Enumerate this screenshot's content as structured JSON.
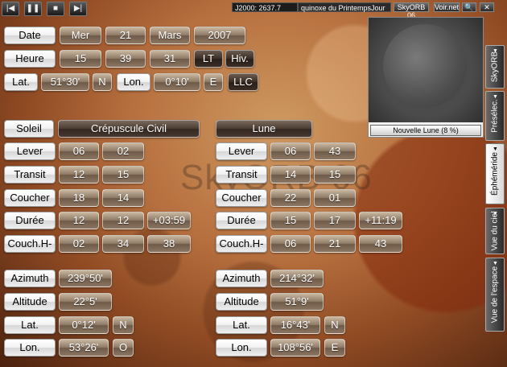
{
  "topbar": {
    "media": [
      "|◀",
      "❚❚",
      "■",
      "▶|"
    ],
    "j2000": "J2000: 2637.7",
    "event": "quinoxe du PrintempsJour",
    "skyorb_version": "SkyORB 06",
    "www": "Voir.net",
    "search_icon": "🔍",
    "close_icon": "✕"
  },
  "date": {
    "label": "Date",
    "weekday": "Mer",
    "day": "21",
    "month": "Mars",
    "year": "2007"
  },
  "time": {
    "label": "Heure",
    "h": "15",
    "m": "39",
    "s": "31",
    "lt": "LT",
    "season": "Hiv."
  },
  "location": {
    "lat_label": "Lat.",
    "lat": "51°30'",
    "lat_dir": "N",
    "lon_label": "Lon.",
    "lon": "0°10'",
    "lon_dir": "E",
    "llc": "LLC"
  },
  "moon_panel": {
    "caption": "Nouvelle Lune (8 %)"
  },
  "watermark": "SkyORB 06",
  "sun": {
    "header": "Soleil",
    "subheader": "Crépuscule Civil",
    "rows": [
      {
        "label": "Lever",
        "a": "06",
        "b": "02",
        "c": ""
      },
      {
        "label": "Transit",
        "a": "12",
        "b": "15",
        "c": ""
      },
      {
        "label": "Coucher",
        "a": "18",
        "b": "14",
        "c": ""
      },
      {
        "label": "Durée",
        "a": "12",
        "b": "12",
        "c": "+03:59"
      },
      {
        "label": "Couch.H-",
        "a": "02",
        "b": "34",
        "c": "38"
      }
    ],
    "azimuth_label": "Azimuth",
    "azimuth": "239°50'",
    "altitude_label": "Altitude",
    "altitude": "22°5'",
    "lat_label": "Lat.",
    "lat": "0°12'",
    "lat_dir": "N",
    "lon_label": "Lon.",
    "lon": "53°26'",
    "lon_dir": "O"
  },
  "moon": {
    "header": "Lune",
    "rows": [
      {
        "label": "Lever",
        "a": "06",
        "b": "43",
        "c": ""
      },
      {
        "label": "Transit",
        "a": "14",
        "b": "15",
        "c": ""
      },
      {
        "label": "Coucher",
        "a": "22",
        "b": "01",
        "c": ""
      },
      {
        "label": "Durée",
        "a": "15",
        "b": "17",
        "c": "+11:19"
      },
      {
        "label": "Couch.H-",
        "a": "06",
        "b": "21",
        "c": "43"
      }
    ],
    "azimuth_label": "Azimuth",
    "azimuth": "214°32'",
    "altitude_label": "Altitude",
    "altitude": "51°9'",
    "lat_label": "Lat.",
    "lat": "16°43'",
    "lat_dir": "N",
    "lon_label": "Lon.",
    "lon": "108°56'",
    "lon_dir": "E"
  },
  "side_tabs": [
    "SkyORB",
    "Présélec.",
    "Éphéméride",
    "Vue du ciel",
    "Vue de l'espace"
  ],
  "colors": {
    "accent_label_bg": "#f0f0f0",
    "value_bg": "#8e7a66",
    "mars_bg": "#b66f3e"
  }
}
